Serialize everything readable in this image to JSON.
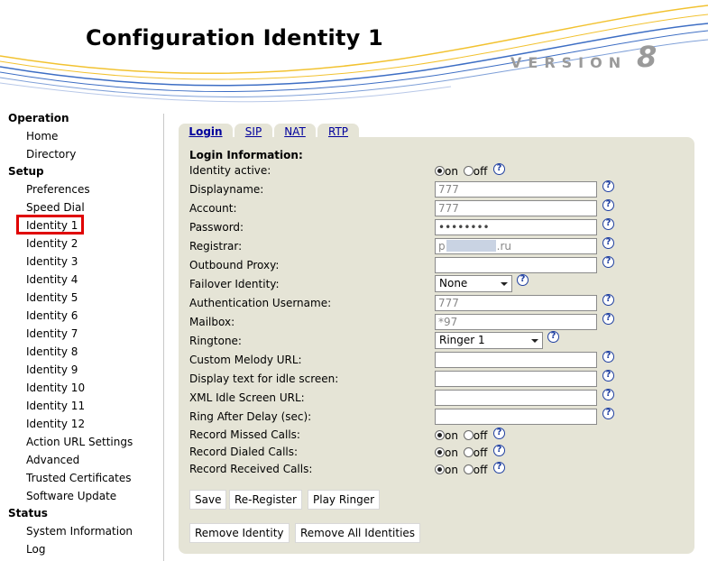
{
  "header": {
    "title": "Configuration Identity 1",
    "version_label": "VERSION",
    "version_number": "8"
  },
  "sidebar": {
    "sections": [
      {
        "label": "Operation",
        "items": [
          "Home",
          "Directory"
        ]
      },
      {
        "label": "Setup",
        "items": [
          "Preferences",
          "Speed Dial",
          "Identity 1",
          "Identity 2",
          "Identity 3",
          "Identity 4",
          "Identity 5",
          "Identity 6",
          "Identity 7",
          "Identity 8",
          "Identity 9",
          "Identity 10",
          "Identity 11",
          "Identity 12",
          "Action URL Settings",
          "Advanced",
          "Trusted Certificates",
          "Software Update"
        ]
      },
      {
        "label": "Status",
        "items": [
          "System Information",
          "Log"
        ]
      }
    ],
    "highlighted_item": "Identity 1",
    "highlight_color": "#e00000"
  },
  "tabs": [
    {
      "label": "Login",
      "active": true
    },
    {
      "label": "SIP",
      "active": false
    },
    {
      "label": "NAT",
      "active": false
    },
    {
      "label": "RTP",
      "active": false
    }
  ],
  "form": {
    "heading": "Login Information:",
    "radio_on": "on",
    "radio_off": "off",
    "help_glyph": "?",
    "fields": {
      "identity_active": {
        "label": "Identity active:",
        "value": "on"
      },
      "displayname": {
        "label": "Displayname:",
        "value": "777"
      },
      "account": {
        "label": "Account:",
        "value": "777"
      },
      "password": {
        "label": "Password:",
        "value": "••••••••"
      },
      "registrar": {
        "label": "Registrar:",
        "value_prefix": "p",
        "value_suffix": ".ru"
      },
      "outbound_proxy": {
        "label": "Outbound Proxy:",
        "value": ""
      },
      "failover_identity": {
        "label": "Failover Identity:",
        "value": "None"
      },
      "auth_username": {
        "label": "Authentication Username:",
        "value": "777"
      },
      "mailbox": {
        "label": "Mailbox:",
        "value": "*97"
      },
      "ringtone": {
        "label": "Ringtone:",
        "value": "Ringer 1"
      },
      "custom_melody_url": {
        "label": "Custom Melody URL:",
        "value": ""
      },
      "idle_display_text": {
        "label": "Display text for idle screen:",
        "value": ""
      },
      "xml_idle_url": {
        "label": "XML Idle Screen URL:",
        "value": ""
      },
      "ring_after_delay": {
        "label": "Ring After Delay (sec):",
        "value": ""
      },
      "record_missed": {
        "label": "Record Missed Calls:",
        "value": "on"
      },
      "record_dialed": {
        "label": "Record Dialed Calls:",
        "value": "on"
      },
      "record_received": {
        "label": "Record Received Calls:",
        "value": "on"
      }
    }
  },
  "buttons": {
    "save": "Save",
    "reregister": "Re-Register",
    "play_ringer": "Play Ringer",
    "remove_identity": "Remove Identity",
    "remove_all": "Remove All Identities"
  },
  "colors": {
    "panel": "#e5e4d6",
    "link": "#00009c",
    "wave_blue": "#3d6ec4",
    "wave_yellow": "#f2c230"
  }
}
